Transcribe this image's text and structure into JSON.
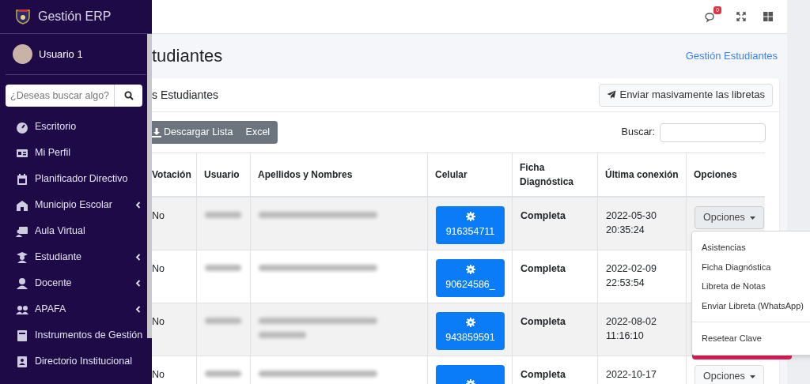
{
  "brand": {
    "title": "Gestión ERP"
  },
  "user": {
    "name": "Usuario 1"
  },
  "sidebar_search": {
    "placeholder": "¿Deseas buscar algo?"
  },
  "sidebar": {
    "items": [
      {
        "label": "Escritorio",
        "has_submenu": false
      },
      {
        "label": "Mi Perfil",
        "has_submenu": false
      },
      {
        "label": "Planificador Directivo",
        "has_submenu": false
      },
      {
        "label": "Municipio Escolar",
        "has_submenu": true
      },
      {
        "label": "Aula Virtual",
        "has_submenu": false
      },
      {
        "label": "Estudiante",
        "has_submenu": true
      },
      {
        "label": "Docente",
        "has_submenu": true
      },
      {
        "label": "APAFA",
        "has_submenu": true
      },
      {
        "label": "Instrumentos de Gestión",
        "has_submenu": false
      },
      {
        "label": "Directorio Institucional",
        "has_submenu": false
      }
    ]
  },
  "navbar": {
    "notification_count": "0"
  },
  "page": {
    "title": "tudiantes",
    "breadcrumb": "Gestión Estudiantes"
  },
  "card": {
    "title": "s Estudiantes",
    "send_button": "Enviar masivamente las libretas",
    "download_buttons": [
      "Descargar Lista",
      "Excel"
    ],
    "search_label": "Buscar:"
  },
  "table": {
    "columns": [
      "Votación",
      "Usuario",
      "Apellidos y Nombres",
      "Celular",
      "Ficha Diagnóstica",
      "Última conexión",
      "Opciones"
    ],
    "rows": [
      {
        "votacion": "No",
        "celular": "916354711",
        "ficha": "Completa",
        "date": "2022-05-30",
        "time": "20:35:24",
        "options": "Opciones",
        "expanded": true
      },
      {
        "votacion": "No",
        "celular": "90624586_",
        "ficha": "Completa",
        "date": "2022-02-09",
        "time": "22:53:54"
      },
      {
        "votacion": "No",
        "celular": "943859591",
        "ficha": "Completa",
        "date": "2022-08-02",
        "time": "11:16:10"
      },
      {
        "votacion": "No",
        "ficha": "Completa",
        "date": "2022-10-17",
        "options": "Opciones",
        "expanded": false
      }
    ]
  },
  "dropdown": {
    "items": [
      {
        "label": "Asistencias",
        "divider_before": false
      },
      {
        "label": "Ficha Diagnóstica",
        "divider_before": false
      },
      {
        "label": "Libreta de Notas",
        "divider_before": false
      },
      {
        "label": "Enviar Libreta (WhatsApp)",
        "divider_before": false
      },
      {
        "label": "Resetear Clave",
        "divider_before": true
      }
    ]
  }
}
